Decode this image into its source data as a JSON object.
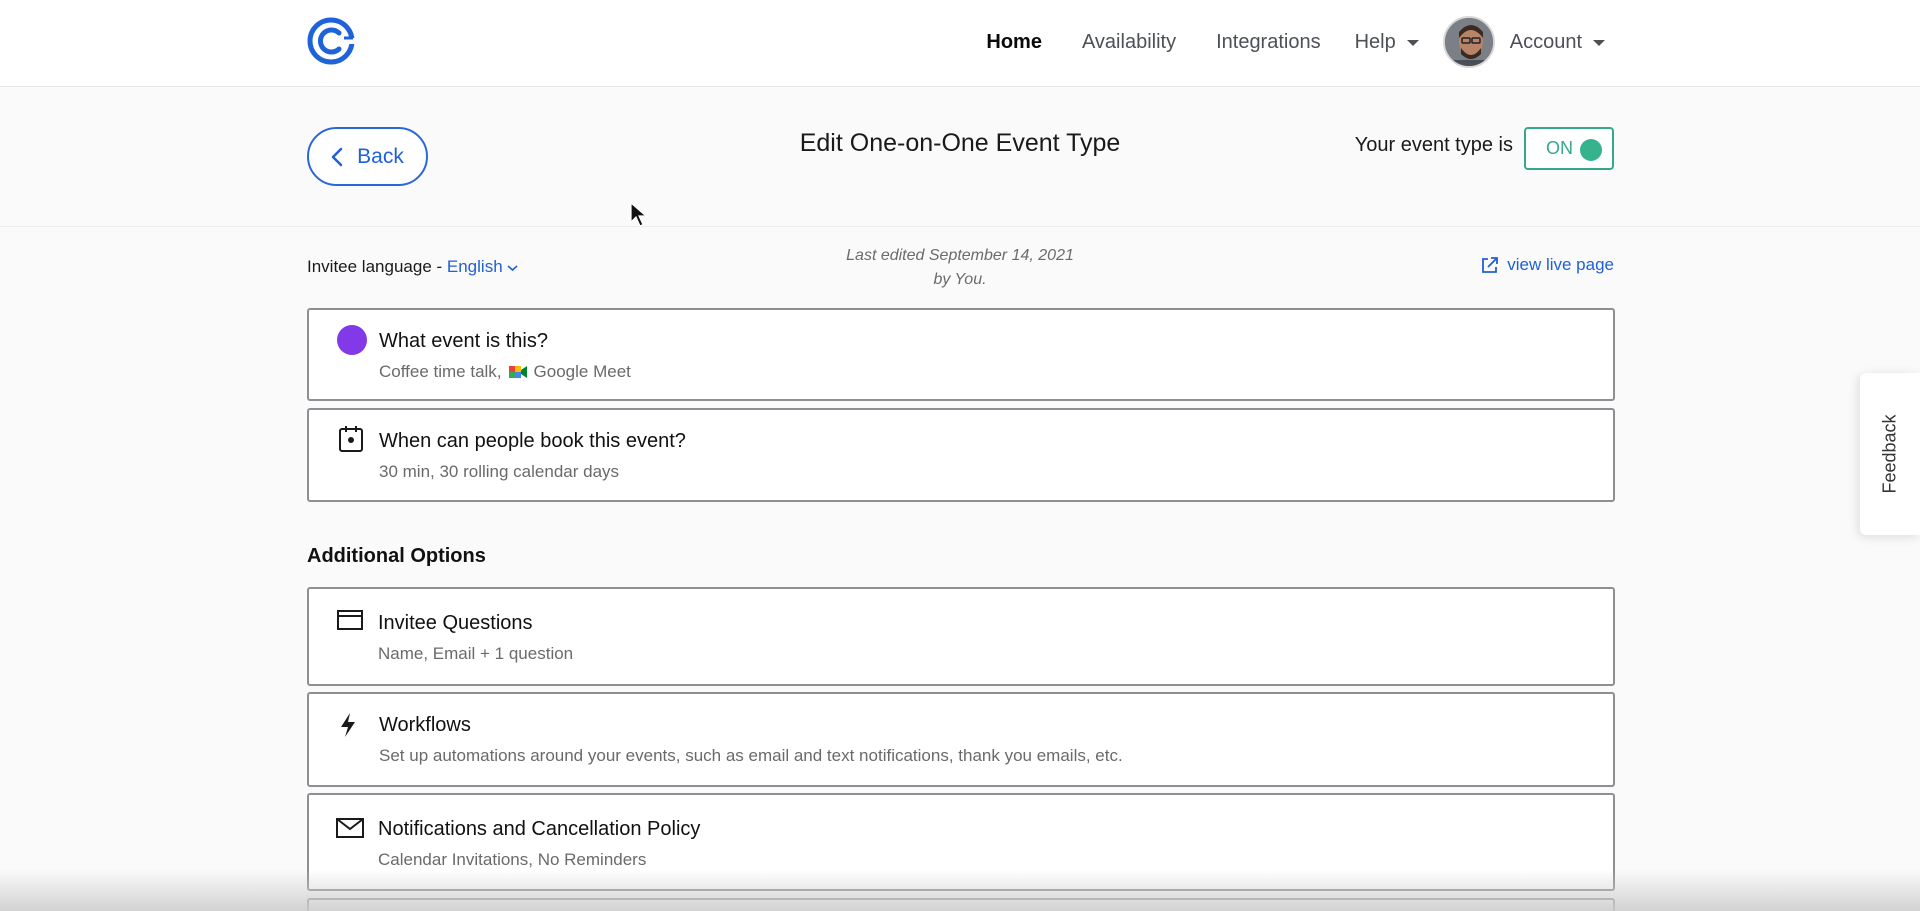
{
  "nav": {
    "home": "Home",
    "availability": "Availability",
    "integrations": "Integrations",
    "help": "Help",
    "account": "Account"
  },
  "header": {
    "back_label": "Back",
    "title": "Edit One-on-One Event Type",
    "status_label": "Your event type is",
    "toggle_label": "ON"
  },
  "meta": {
    "language_label": "Invitee language -",
    "language_value": "English",
    "last_edited_line1": "Last edited September 14, 2021",
    "last_edited_line2": "by You.",
    "view_live": "view live page"
  },
  "cards": [
    {
      "title": "What event is this?",
      "subtitle_prefix": "Coffee time talk,",
      "subtitle_suffix": "Google Meet",
      "icon": "purple-dot-icon"
    },
    {
      "title": "When can people book this event?",
      "subtitle": "30 min, 30 rolling calendar days",
      "icon": "calendar-icon"
    }
  ],
  "additional": {
    "title": "Additional Options",
    "items": [
      {
        "title": "Invitee Questions",
        "subtitle": "Name, Email + 1 question",
        "icon": "form-icon"
      },
      {
        "title": "Workflows",
        "subtitle": "Set up automations around your events, such as email and text notifications, thank you emails, etc.",
        "icon": "lightning-icon"
      },
      {
        "title": "Notifications and Cancellation Policy",
        "subtitle": "Calendar Invitations, No Reminders",
        "icon": "envelope-icon"
      }
    ]
  },
  "feedback": "Feedback",
  "colors": {
    "brand_blue": "#2060d8",
    "toggle_green": "#35a88a",
    "event_purple": "#8239e8"
  }
}
